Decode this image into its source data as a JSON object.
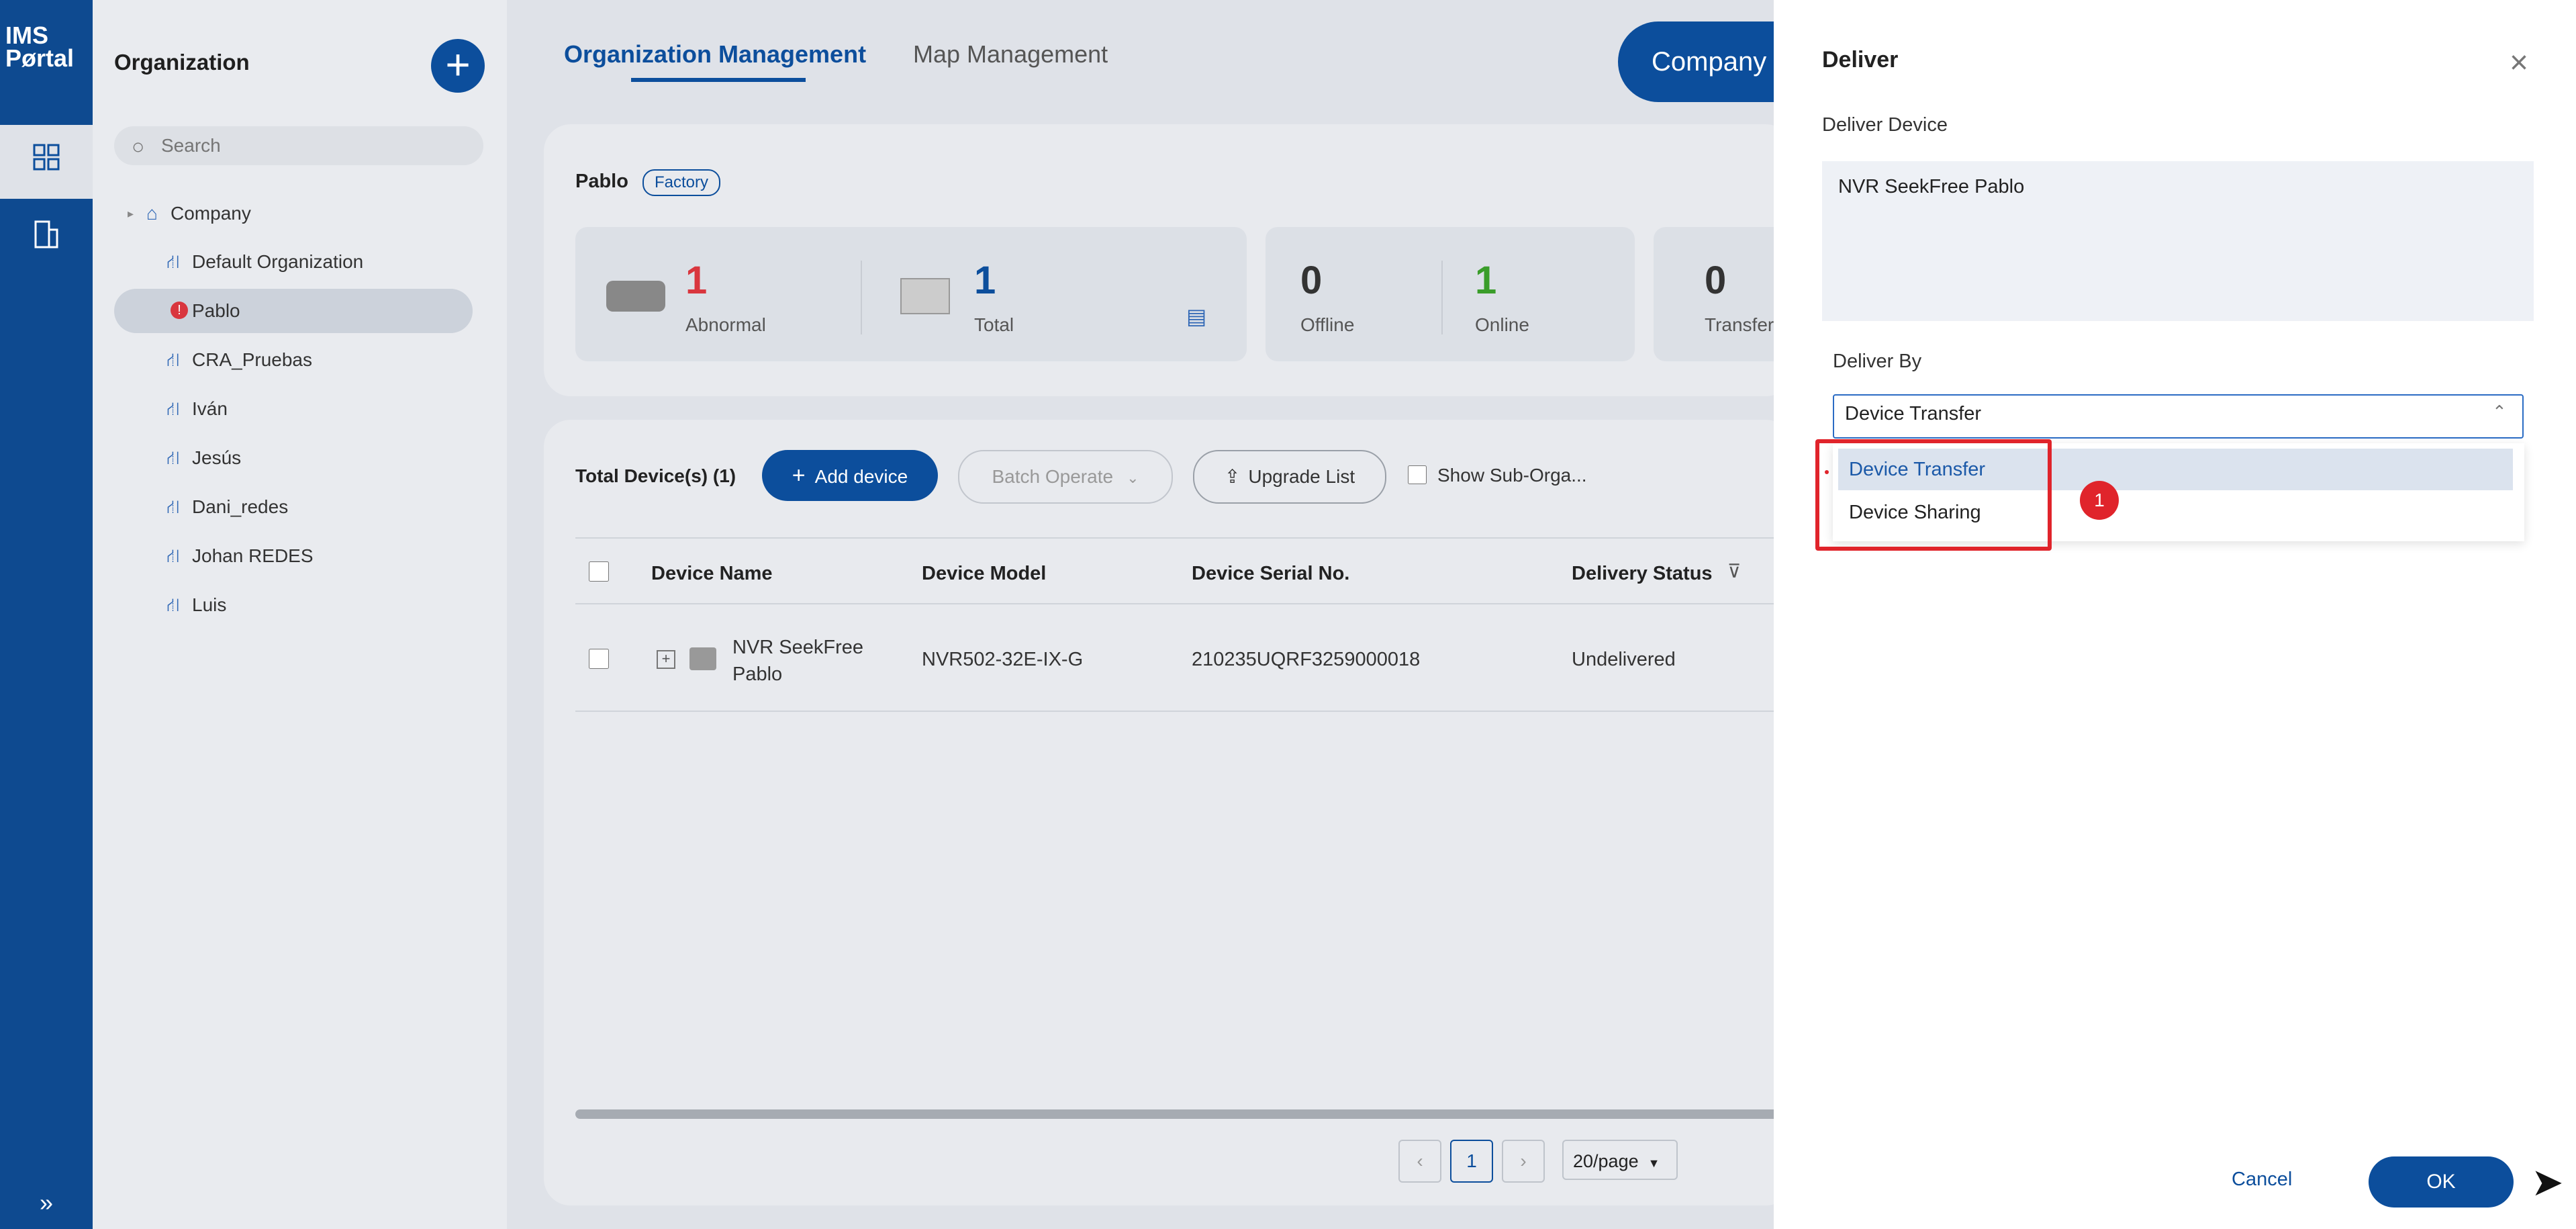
{
  "app": {
    "logo_line1": "IMS",
    "logo_line2": "Pørtal"
  },
  "rail": {
    "icons": [
      "dashboard-grid-icon",
      "building-icon"
    ],
    "expand_icon": "double-chevron-right-icon"
  },
  "org_panel": {
    "title": "Organization",
    "search_placeholder": "Search",
    "tree": [
      {
        "label": "Company",
        "level": 0,
        "icon": "company-icon"
      },
      {
        "label": "Default Organization",
        "level": 1,
        "icon": "org-network-icon"
      },
      {
        "label": "Pablo",
        "level": 1,
        "icon": "alert-icon",
        "selected": true
      },
      {
        "label": "CRA_Pruebas",
        "level": 1,
        "icon": "org-network-icon"
      },
      {
        "label": "Iván",
        "level": 1,
        "icon": "org-network-icon"
      },
      {
        "label": "Jesús",
        "level": 1,
        "icon": "org-network-icon"
      },
      {
        "label": "Dani_redes",
        "level": 1,
        "icon": "org-network-icon"
      },
      {
        "label": "Johan REDES",
        "level": 1,
        "icon": "org-network-icon"
      },
      {
        "label": "Luis",
        "level": 1,
        "icon": "org-network-icon"
      }
    ]
  },
  "main": {
    "tabs": [
      "Organization Management",
      "Map Management"
    ],
    "company_button": "Company",
    "org_name": "Pablo",
    "org_tag": "Factory",
    "stats": [
      {
        "value": "1",
        "label": "Abnormal",
        "color": "#d9363e"
      },
      {
        "value": "1",
        "label": "Total",
        "color": "#0c4e9c"
      },
      {
        "value": "0",
        "label": "Offline",
        "color": "#333333"
      },
      {
        "value": "1",
        "label": "Online",
        "color": "#3a9d2a"
      },
      {
        "value": "0",
        "label": "Transfer",
        "color": "#333333"
      }
    ],
    "toolbar": {
      "total_devices": "Total Device(s) (1)",
      "add_device": "Add device",
      "batch_operate": "Batch Operate",
      "upgrade_list": "Upgrade List",
      "show_sub_org": "Show Sub-Orga..."
    },
    "table": {
      "headers": [
        "Device Name",
        "Device Model",
        "Device Serial No.",
        "Delivery Status"
      ],
      "rows": [
        {
          "name_line1": "NVR SeekFree",
          "name_line2": "Pablo",
          "model": "NVR502-32E-IX-G",
          "serial": "210235UQRF3259000018",
          "status": "Undelivered"
        }
      ]
    },
    "pagination": {
      "current_page": "1",
      "per_page": "20/page"
    }
  },
  "dialog": {
    "title": "Deliver",
    "deliver_device_label": "Deliver Device",
    "deliver_device_value": "NVR SeekFree Pablo",
    "deliver_by_label": "Deliver By",
    "deliver_by_selected": "Device Transfer",
    "options": [
      "Device Transfer",
      "Device Sharing"
    ],
    "annotation_number": "1",
    "cancel": "Cancel",
    "ok": "OK"
  }
}
